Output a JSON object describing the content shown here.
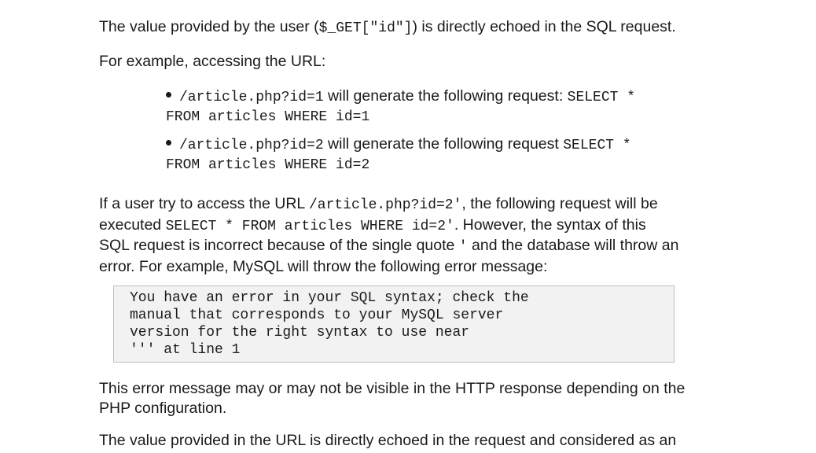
{
  "document": {
    "p1": {
      "a": "The value provided by the user (",
      "code": "$_GET[\"id\"]",
      "b": ") is directly echoed in the SQL request."
    },
    "p2": "For example, accessing the URL:",
    "bullets": [
      {
        "url": "/article.php?id=1",
        "text": " will generate the following request: ",
        "sql_part1": "SELECT *",
        "sql_part2": "FROM articles WHERE id=1"
      },
      {
        "url": "/article.php?id=2",
        "text": " will generate the following request ",
        "sql_part1": "SELECT *",
        "sql_part2": "FROM articles WHERE id=2"
      }
    ],
    "p3": {
      "l1_a": "If a user try to access the URL ",
      "l1_code": "/article.php?id=2'",
      "l1_b": ", the following request will be",
      "l2_a": "executed ",
      "l2_code": "SELECT * FROM articles WHERE id=2'",
      "l2_b": ". However, the syntax of this",
      "l3_a": "SQL request is incorrect because of the single quote ",
      "l3_code": "'",
      "l3_b": " and the database will throw an",
      "l4": "error. For example, MySQL will throw the following error message:"
    },
    "code_block": [
      "You have an error in your SQL syntax; check the",
      "manual that corresponds to your MySQL server",
      "version for the right syntax to use near",
      "''' at line 1"
    ],
    "p4": {
      "l1": "This error message may or may not be visible in the HTTP response depending on the",
      "l2": "PHP configuration."
    },
    "p5": {
      "l1": "The value provided in the URL is directly echoed in the request and considered as an"
    }
  }
}
